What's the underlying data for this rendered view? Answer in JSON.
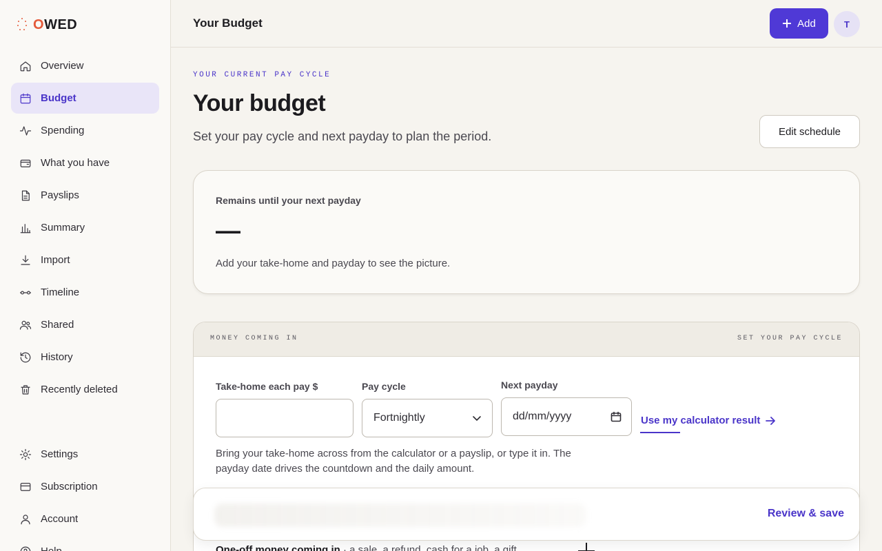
{
  "app": {
    "logo_o": "O",
    "logo_rest": "WED"
  },
  "sidebar": {
    "items": [
      {
        "label": "Overview",
        "icon": "home-icon"
      },
      {
        "label": "Budget",
        "icon": "calendar-icon",
        "active": true
      },
      {
        "label": "Spending",
        "icon": "pulse-icon"
      },
      {
        "label": "What you have",
        "icon": "wallet-icon"
      },
      {
        "label": "Payslips",
        "icon": "document-icon"
      },
      {
        "label": "Summary",
        "icon": "bar-chart-icon"
      },
      {
        "label": "Import",
        "icon": "download-icon"
      },
      {
        "label": "Timeline",
        "icon": "timeline-icon"
      },
      {
        "label": "Shared",
        "icon": "users-icon"
      },
      {
        "label": "History",
        "icon": "history-icon"
      },
      {
        "label": "Recently deleted",
        "icon": "trash-icon"
      }
    ],
    "bottom_items": [
      {
        "label": "Settings",
        "icon": "gear-icon"
      },
      {
        "label": "Subscription",
        "icon": "card-icon"
      },
      {
        "label": "Account",
        "icon": "user-icon"
      },
      {
        "label": "Help",
        "icon": "help-icon"
      }
    ]
  },
  "header": {
    "title": "Your Budget",
    "add_label": "Add",
    "avatar_initial": "T"
  },
  "main": {
    "eyebrow": "YOUR CURRENT PAY CYCLE",
    "title": "Your budget",
    "subtitle": "Set your pay cycle and next payday to plan the period.",
    "edit_schedule": "Edit schedule",
    "remains": {
      "label": "Remains until your next payday",
      "value": "—",
      "note": "Add your take-home and payday to see the picture."
    },
    "income": {
      "header_left": "MONEY COMING IN",
      "header_right": "SET YOUR PAY CYCLE",
      "takehome_label": "Take-home each pay $",
      "takehome_value": "",
      "cycle_label": "Pay cycle",
      "cycle_value": "Fortnightly",
      "payday_label": "Next payday",
      "payday_placeholder": "dd/mm/yyyy",
      "calc_link": "Use my calculator result",
      "help": "Bring your take-home across from the calculator or a payslip, or type it in. The payday date drives the countdown and the daily amount.",
      "oneoff_bold": "One-off money coming in",
      "oneoff_rest": " · a sale, a refund, cash for a job, a gift"
    },
    "save_bar": {
      "review_label": "Review & save"
    }
  },
  "colors": {
    "accent": "#4f39d6",
    "brand_orange": "#e45a3a",
    "active_bg": "#e9e5f8"
  }
}
